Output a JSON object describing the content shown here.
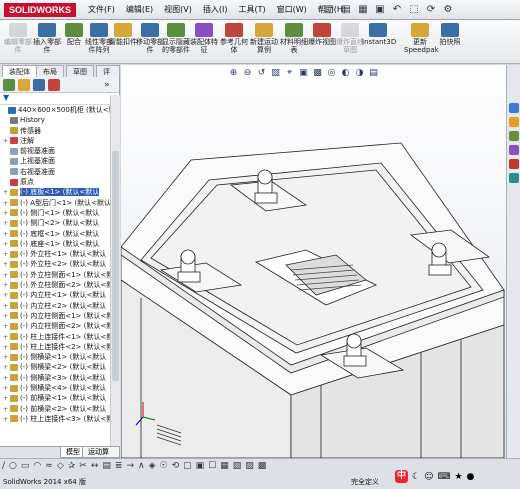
{
  "app": {
    "logo_text": "SOLIDWORKS"
  },
  "menu": [
    "文件(F)",
    "编辑(E)",
    "视图(V)",
    "插入(I)",
    "工具(T)",
    "窗口(W)",
    "帮助(H)"
  ],
  "quick_access": [
    "new-icon",
    "open-icon",
    "save-icon",
    "print-icon",
    "undo-icon",
    "select-icon",
    "rebuild-icon",
    "options-icon"
  ],
  "ribbon": [
    {
      "label": "编辑零部件",
      "enabled": false
    },
    {
      "label": "插入零部件",
      "enabled": true
    },
    {
      "label": "配合",
      "enabled": true
    },
    {
      "label": "线性零部件阵列",
      "enabled": true
    },
    {
      "label": "智能扣件",
      "enabled": true
    },
    {
      "label": "移动零部件",
      "enabled": true
    },
    {
      "label": "显示隐藏的零部件",
      "enabled": true
    },
    {
      "label": "装配体特征",
      "enabled": true
    },
    {
      "label": "参考几何体",
      "enabled": true
    },
    {
      "label": "新建运动算例",
      "enabled": true
    },
    {
      "label": "材料明细表",
      "enabled": true
    },
    {
      "label": "爆炸视图",
      "enabled": true
    },
    {
      "label": "爆炸直线草图",
      "enabled": false
    },
    {
      "label": "Instant3D",
      "enabled": true
    },
    {
      "label": "更新 Speedpak",
      "enabled": true
    },
    {
      "label": "拍快照",
      "enabled": true
    }
  ],
  "tabs": [
    "装配体",
    "布局",
    "草图",
    "评估"
  ],
  "filter_icon": "filter-icon",
  "tree": [
    {
      "expander": "",
      "label": "440×600×500机柜  (默认<默认_显示"
    },
    {
      "expander": "",
      "label": "History"
    },
    {
      "expander": "",
      "label": "传感器"
    },
    {
      "expander": "+",
      "label": "注解"
    },
    {
      "expander": "",
      "label": "前视基准面"
    },
    {
      "expander": "",
      "label": "上视基准面"
    },
    {
      "expander": "",
      "label": "右视基准面"
    },
    {
      "expander": "",
      "label": "原点"
    },
    {
      "expander": "+",
      "label": "(-) 底板<1> (默认<默认",
      "selected": true
    },
    {
      "expander": "+",
      "label": "(-) A型后门<1> (默认<默认"
    },
    {
      "expander": "+",
      "label": "(-) 侧门<1> (默认<默认"
    },
    {
      "expander": "+",
      "label": "(-) 侧门<2> (默认<默认"
    },
    {
      "expander": "+",
      "label": "(-) 底框<1> (默认<默认"
    },
    {
      "expander": "+",
      "label": "(-) 底座<1> (默认<默认"
    },
    {
      "expander": "+",
      "label": "(-) 外立柱<1> (默认<默认"
    },
    {
      "expander": "+",
      "label": "(-) 外立柱<2> (默认<默认"
    },
    {
      "expander": "+",
      "label": "(-) 外立柱侧面<1> (默认<默认"
    },
    {
      "expander": "+",
      "label": "(-) 外立柱侧面<2> (默认<默认"
    },
    {
      "expander": "+",
      "label": "(-) 内立柱<1> (默认<默认"
    },
    {
      "expander": "+",
      "label": "(-) 内立柱<2> (默认<默认"
    },
    {
      "expander": "+",
      "label": "(-) 内立柱侧面<1> (默认<默认"
    },
    {
      "expander": "+",
      "label": "(-) 内立柱侧面<2> (默认<默认"
    },
    {
      "expander": "+",
      "label": "(-) 柱上连接件<1> (默认<默认"
    },
    {
      "expander": "+",
      "label": "(-) 柱上连接件<2> (默认<默认"
    },
    {
      "expander": "+",
      "label": "(-) 侧横梁<1> (默认<默认"
    },
    {
      "expander": "+",
      "label": "(-) 侧横梁<2> (默认<默认"
    },
    {
      "expander": "+",
      "label": "(-) 侧横梁<3> (默认<默认"
    },
    {
      "expander": "+",
      "label": "(-) 侧横梁<4> (默认<默认"
    },
    {
      "expander": "+",
      "label": "(-) 前横梁<1> (默认<默认"
    },
    {
      "expander": "+",
      "label": "(-) 前横梁<2> (默认<默认"
    },
    {
      "expander": "+",
      "label": "(-) 柱上连接件<3> (默认<默认"
    }
  ],
  "bottom_tabs": [
    "模型",
    "运动算例 1"
  ],
  "status": {
    "left": "SolidWorks 2014 x64 版",
    "right": "完全定义"
  },
  "ime": {
    "logo": "中",
    "items": [
      "☾",
      "☺",
      "⌨",
      "★",
      "●"
    ]
  },
  "headsup_icons": [
    "zoom-fit-icon",
    "zoom-area-icon",
    "previous-view-icon",
    "section-view-icon",
    "dynamic-annotation-icon",
    "view-orientation-icon",
    "display-style-icon",
    "hide-show-icon",
    "edit-appearance-icon",
    "apply-scene-icon",
    "view-settings-icon"
  ],
  "headsup_glyphs": [
    "⊕",
    "⊖",
    "↺",
    "▧",
    "⌖",
    "▣",
    "▩",
    "◎",
    "◐",
    "◑",
    "▤"
  ],
  "taskpane_colors": [
    "#3a7bd5",
    "#e0a020",
    "#6a8f3c",
    "#8a4fbf",
    "#c0392b",
    "#2e8b8b"
  ],
  "sketch_glyphs": [
    "∕",
    "○",
    "▭",
    "◠",
    "≈",
    "◇",
    "✰",
    "✂",
    "↔",
    "▤",
    "≣",
    "→",
    "∧",
    "◈",
    "☉",
    "⟲",
    "▢",
    "▣",
    "☐",
    "▦",
    "▧",
    "▨",
    "▩"
  ]
}
